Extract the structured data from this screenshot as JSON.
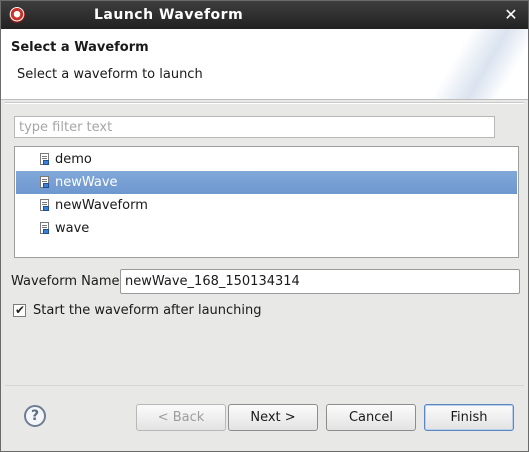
{
  "window": {
    "title": "Launch Waveform",
    "close_glyph": "✕"
  },
  "header": {
    "title": "Select a Waveform",
    "description": "Select a waveform to launch"
  },
  "filter": {
    "placeholder": "type filter text",
    "value": ""
  },
  "tree": {
    "items": [
      {
        "label": "demo",
        "icon": "waveform-file-icon",
        "selected": false
      },
      {
        "label": "newWave",
        "icon": "waveform-file-icon",
        "selected": true
      },
      {
        "label": "newWaveform",
        "icon": "waveform-file-icon",
        "selected": false
      },
      {
        "label": "wave",
        "icon": "waveform-file-icon",
        "selected": false
      }
    ]
  },
  "form": {
    "name_label": "Waveform Name:",
    "name_value": "newWave_168_150134314",
    "start_after_label": "Start the waveform after launching",
    "start_after_checked": true
  },
  "footer": {
    "help_glyph": "?",
    "back_label": "< Back",
    "back_enabled": false,
    "next_label": "Next >",
    "cancel_label": "Cancel",
    "finish_label": "Finish"
  },
  "colors": {
    "titlebar": "#2e2e2e",
    "selection": "#7aa0d6",
    "dialog_bg": "#e8e8e7"
  }
}
